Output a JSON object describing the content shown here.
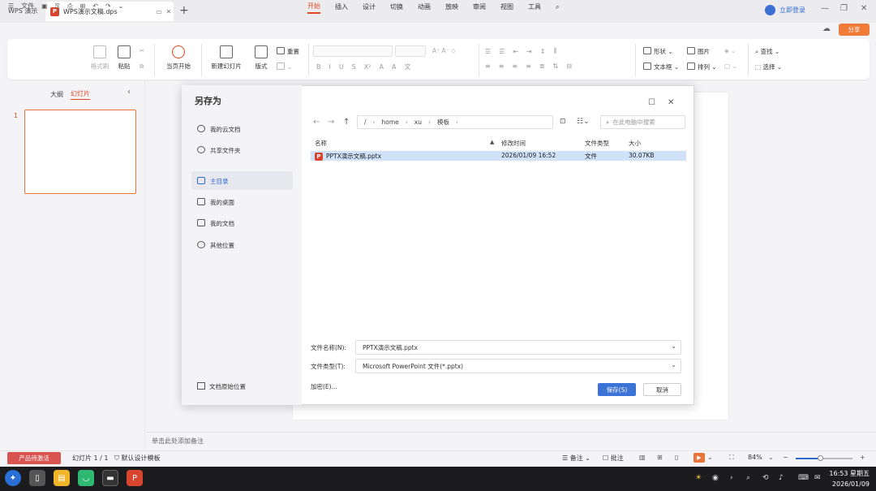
{
  "titlebar": {
    "app_tab": "WPS 演示",
    "doc_tab": "WPS演示文稿.dps",
    "login": "立即登录",
    "new_tab": "+"
  },
  "menubar": {
    "file": "文件",
    "tabs": [
      "开始",
      "插入",
      "设计",
      "切换",
      "动画",
      "放映",
      "审阅",
      "视图",
      "工具"
    ],
    "active_tab": "开始",
    "share": "分享"
  },
  "ribbon": {
    "format_painter": "格式刷",
    "paste": "粘贴",
    "from_start": "当页开始",
    "new_slide": "新建幻灯片",
    "layout": "版式",
    "reset": "重置",
    "shape": "形状",
    "picture": "图片",
    "textbox": "文本框",
    "arrange": "排列",
    "find": "查找",
    "select": "选择"
  },
  "left_panel": {
    "tab_outline": "大纲",
    "tab_slides": "幻灯片",
    "slide_number": "1"
  },
  "notes_placeholder": "单击此处添加备注",
  "statusbar": {
    "activate": "产品待激活",
    "slide_info": "幻灯片 1 / 1",
    "template": "默认设计模板",
    "notes": "备注",
    "comments": "批注",
    "zoom": "84%",
    "zoom_fraction": 0.43
  },
  "taskbar": {
    "time": "16:53 星期五",
    "date": "2026/01/09"
  },
  "dialog": {
    "title": "另存为",
    "sidebar": [
      {
        "label": "我的云文档",
        "icon": "cloud-icon"
      },
      {
        "label": "共享文件夹",
        "icon": "share-folder-icon"
      },
      {
        "label": "主目录",
        "icon": "home-icon",
        "active": true
      },
      {
        "label": "我的桌面",
        "icon": "folder-icon"
      },
      {
        "label": "我的文档",
        "icon": "folder-icon"
      },
      {
        "label": "其他位置",
        "icon": "more-icon"
      }
    ],
    "original_location": "文档原始位置",
    "path": [
      "/",
      "home",
      "xu",
      "模板"
    ],
    "search_placeholder": "在此电脑中搜索",
    "columns": {
      "name": "名称",
      "modified": "修改时间",
      "type": "文件类型",
      "size": "大小"
    },
    "files": [
      {
        "name": "PPTX演示文稿.pptx",
        "modified": "2026/01/09 16:52",
        "type": "文件",
        "size": "30.07KB"
      }
    ],
    "filename_label": "文件名称(N):",
    "filename_value": "PPTX演示文稿.pptx",
    "filetype_label": "文件类型(T):",
    "filetype_value": "Microsoft PowerPoint 文件(*.pptx)",
    "encrypt": "加密(E)...",
    "save": "保存(S)",
    "cancel": "取消"
  }
}
